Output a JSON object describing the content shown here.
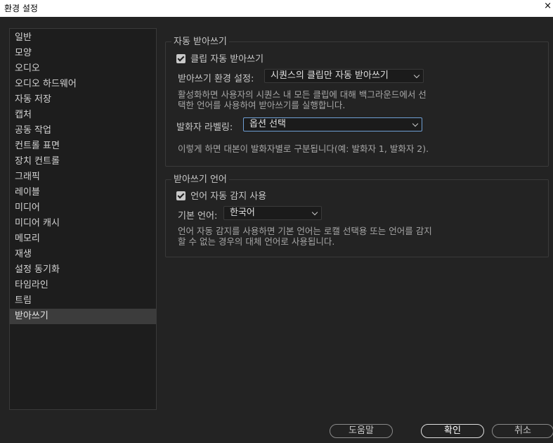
{
  "window": {
    "title": "환경 설정",
    "close_glyph": "×"
  },
  "sidebar": {
    "items": [
      {
        "label": "일반"
      },
      {
        "label": "모양"
      },
      {
        "label": "오디오"
      },
      {
        "label": "오디오 하드웨어"
      },
      {
        "label": "자동 저장"
      },
      {
        "label": "캡처"
      },
      {
        "label": "공동 작업"
      },
      {
        "label": "컨트롤 표면"
      },
      {
        "label": "장치 컨트롤"
      },
      {
        "label": "그래픽"
      },
      {
        "label": "레이블"
      },
      {
        "label": "미디어"
      },
      {
        "label": "미디어 캐시"
      },
      {
        "label": "메모리"
      },
      {
        "label": "재생"
      },
      {
        "label": "설정 동기화"
      },
      {
        "label": "타임라인"
      },
      {
        "label": "트림"
      },
      {
        "label": "받아쓰기"
      }
    ],
    "selected": "받아쓰기"
  },
  "auto_transcribe": {
    "title": "자동 받아쓰기",
    "checkbox_label": "클립 자동 받아쓰기",
    "checked": true,
    "preset_label": "받아쓰기 환경 설정:",
    "preset_value": "시퀀스의 클립만 자동 받아쓰기",
    "description": "활성화하면 사용자의 시퀀스 내 모든 클립에 대해 백그라운드에서 선\n택한 언어를 사용하여 받아쓰기를 실행합니다.",
    "speaker_label": "발화자 라벨링:",
    "speaker_value": "옵션 선택",
    "speaker_note": "이렇게 하면 대본이 발화자별로 구분됩니다(예: 발화자 1, 발화자 2)."
  },
  "language": {
    "title": "받아쓰기 언어",
    "checkbox_label": "언어 자동 감지 사용",
    "checked": true,
    "default_label": "기본 언어:",
    "default_value": "한국어",
    "description": "언어 자동 감지를 사용하면 기본 언어는 로캘 선택용 또는 언어를 감지\n할 수 없는 경우의 대체 언어로 사용됩니다."
  },
  "buttons": {
    "help": "도움말",
    "ok": "확인",
    "cancel": "취소"
  },
  "colors": {
    "background": "#232323",
    "panel": "#1d1d1d",
    "selected": "#3c3c3c",
    "focus": "#6f9fd4"
  },
  "icons": {
    "checkbox": "checkmark-icon",
    "dropdown": "chevron-down-icon",
    "close": "close-icon"
  }
}
